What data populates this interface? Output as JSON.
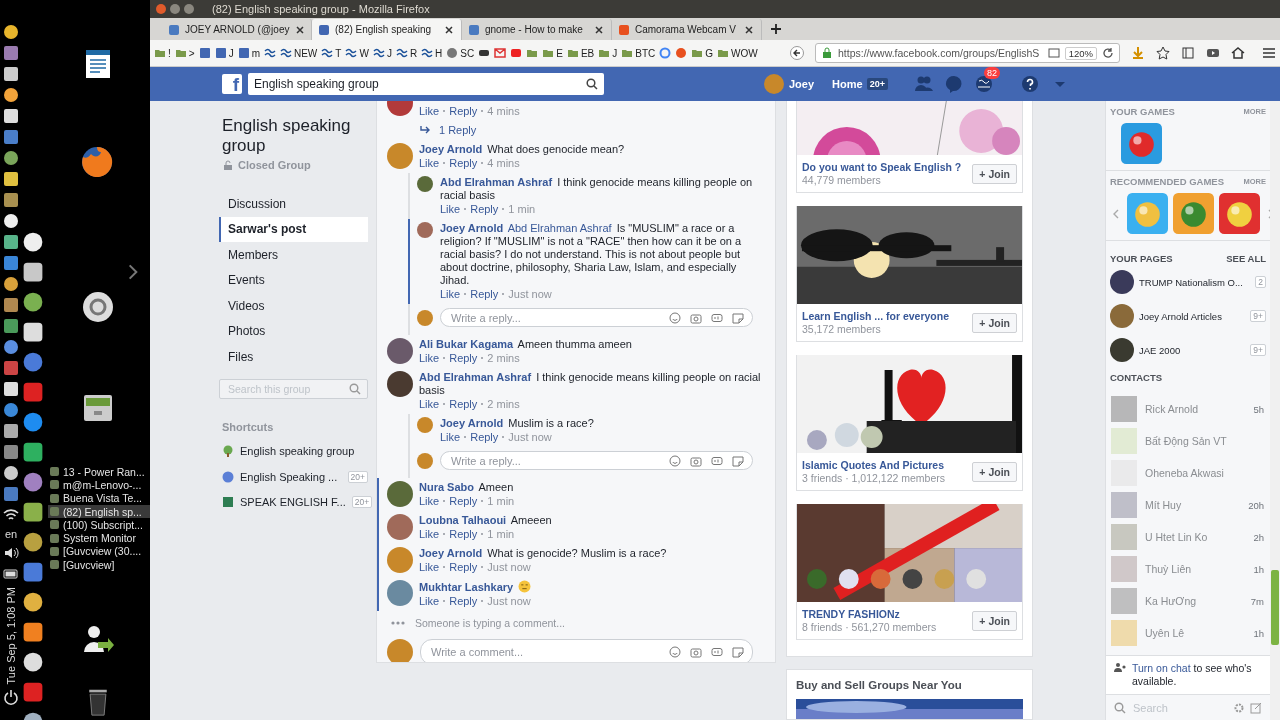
{
  "desktop": {
    "language": "en",
    "clock": "Tue Sep 5, 1:08 PM",
    "windows": [
      {
        "title": "13 - Power Ran...",
        "selected": false
      },
      {
        "title": "m@m-Lenovo-...",
        "selected": false
      },
      {
        "title": "Buena Vista Te...",
        "selected": false
      },
      {
        "title": "(82) English sp...",
        "selected": true
      },
      {
        "title": "(100) Subscript...",
        "selected": false
      },
      {
        "title": "System Monitor",
        "selected": false
      },
      {
        "title": "[Guvcview  (30....",
        "selected": false
      },
      {
        "title": "[Guvcview]",
        "selected": false
      }
    ]
  },
  "browser": {
    "title": "(82) English speaking group - Mozilla Firefox",
    "tabs": [
      {
        "label": "JOEY ARNOLD (@joey",
        "selected": false
      },
      {
        "label": "(82) English speaking",
        "selected": true
      },
      {
        "label": "gnome - How to make",
        "selected": false
      },
      {
        "label": "Camorama Webcam V",
        "selected": false
      }
    ],
    "bookmarks": [
      {
        "kind": "folder",
        "label": "!"
      },
      {
        "kind": "folder",
        "label": ">"
      },
      {
        "kind": "fb"
      },
      {
        "kind": "fb",
        "label": "J"
      },
      {
        "kind": "fb",
        "label": "m"
      },
      {
        "kind": "steem"
      },
      {
        "kind": "steem",
        "label": "NEW"
      },
      {
        "kind": "steem",
        "label": "T"
      },
      {
        "kind": "steem",
        "label": "W"
      },
      {
        "kind": "steem",
        "label": "J"
      },
      {
        "kind": "steem",
        "label": "R"
      },
      {
        "kind": "steem",
        "label": "H"
      },
      {
        "kind": "globe",
        "label": "SC"
      },
      {
        "kind": "car"
      },
      {
        "kind": "mail"
      },
      {
        "kind": "video"
      },
      {
        "kind": "folder"
      },
      {
        "kind": "folder",
        "label": "E"
      },
      {
        "kind": "folder",
        "label": "EB"
      },
      {
        "kind": "folder",
        "label": "J"
      },
      {
        "kind": "folder",
        "label": "BTC"
      },
      {
        "kind": "google"
      },
      {
        "kind": "orange"
      },
      {
        "kind": "folder",
        "label": "G"
      },
      {
        "kind": "folder",
        "label": "WOW"
      }
    ],
    "url": "https://www.facebook.com/groups/EnglishS",
    "zoom": "120%"
  },
  "facebook": {
    "logo": "f",
    "search": {
      "value": "English speaking group"
    },
    "user": "Joey",
    "home": "Home",
    "home_count": "20+",
    "notifications": "82"
  },
  "group": {
    "title": "English speaking group",
    "privacy": "Closed Group",
    "nav": [
      {
        "label": "Discussion",
        "selected": false
      },
      {
        "label": "Sarwar's post",
        "selected": true
      },
      {
        "label": "Members",
        "selected": false
      },
      {
        "label": "Events",
        "selected": false
      },
      {
        "label": "Videos",
        "selected": false
      },
      {
        "label": "Photos",
        "selected": false
      },
      {
        "label": "Files",
        "selected": false
      }
    ],
    "search": {
      "placeholder": "Search this group"
    },
    "shortcuts_title": "Shortcuts",
    "shortcuts": [
      {
        "label": "English speaking group"
      },
      {
        "label": "English Speaking ...",
        "count": "20+"
      },
      {
        "label": "SPEAK ENGLISH F...",
        "count": "20+"
      }
    ]
  },
  "comments": [
    {
      "like": "Like",
      "reply": "Reply",
      "time": "4 mins",
      "highlighted": false,
      "replies_link": "1 Reply"
    },
    {
      "name": "Joey Arnold",
      "text": "What does genocide mean?",
      "like": "Like",
      "reply": "Reply",
      "time": "4 mins",
      "highlighted": false,
      "replies": [
        {
          "name": "Abd Elrahman Ashraf",
          "text": "I think genocide means killing people on racial basis",
          "like": "Like",
          "reply": "Reply",
          "time": "1 min",
          "highlighted": false
        },
        {
          "name": "Joey Arnold",
          "mention": "Abd Elrahman Ashraf",
          "text": "Is \"MUSLIM\" a race or a religion? If \"MUSLIM\" is not a \"RACE\" then how can it be on a racial basis? I do not understand. This is not about people but about doctrine, philosophy, Sharia Law, Islam, and especially Jihad.",
          "like": "Like",
          "reply": "Reply",
          "time": "Just now",
          "highlighted": true
        }
      ],
      "reply_box": {
        "placeholder": "Write a reply..."
      }
    },
    {
      "name": "Ali Bukar Kagama",
      "text": "Ameen thumma ameen",
      "like": "Like",
      "reply": "Reply",
      "time": "2 mins",
      "highlighted": false
    },
    {
      "name": "Abd Elrahman Ashraf",
      "text": "I think genocide means killing people on racial basis",
      "like": "Like",
      "reply": "Reply",
      "time": "2 mins",
      "highlighted": false,
      "replies": [
        {
          "name": "Joey Arnold",
          "text": "Muslim is a race?",
          "like": "Like",
          "reply": "Reply",
          "time": "Just now",
          "highlighted": false
        }
      ],
      "reply_box": {
        "placeholder": "Write a reply..."
      }
    },
    {
      "name": "Nura Sabo",
      "text": "Ameen",
      "like": "Like",
      "reply": "Reply",
      "time": "1 min",
      "highlighted": true
    },
    {
      "name": "Loubna Talhaoui",
      "text": "Ameeen",
      "like": "Like",
      "reply": "Reply",
      "time": "1 min",
      "highlighted": true
    },
    {
      "name": "Joey Arnold",
      "text": "What is genocide? Muslim is a race?",
      "like": "Like",
      "reply": "Reply",
      "time": "Just now",
      "highlighted": true
    },
    {
      "name": "Mukhtar Lashkary",
      "emoji": true,
      "like": "Like",
      "reply": "Reply",
      "time": "Just now",
      "highlighted": true
    }
  ],
  "typing": "Someone is typing a comment...",
  "comment_box": {
    "placeholder": "Write a comment..."
  },
  "suggested_groups": [
    {
      "name": "Do you want to Speak English ?",
      "members": "44,779 members",
      "join": "+ Join"
    },
    {
      "name": "Learn English ... for everyone",
      "members": "35,172 members",
      "join": "+ Join"
    },
    {
      "name": "Islamic Quotes And Pictures",
      "members": "3 friends · 1,012,122 members",
      "join": "+ Join"
    },
    {
      "name": "TRENDY FASHIONz",
      "members": "8 friends · 561,270 members",
      "join": "+ Join"
    }
  ],
  "buy_sell": {
    "title": "Buy and Sell Groups Near You"
  },
  "sidebar": {
    "games": {
      "title": "YOUR GAMES",
      "more": "MORE"
    },
    "recommended": {
      "title": "RECOMMENDED GAMES",
      "more": "MORE"
    },
    "pages": {
      "title": "YOUR PAGES",
      "see_all": "SEE ALL",
      "items": [
        {
          "name": "TRUMP Nationalism O...",
          "count": "2"
        },
        {
          "name": "Joey Arnold Articles",
          "count": "9+"
        },
        {
          "name": "JAE 2000",
          "count": "9+"
        }
      ]
    },
    "contacts": {
      "title": "CONTACTS",
      "chat_on": false,
      "items": [
        {
          "name": "Rick Arnold",
          "time": "5h"
        },
        {
          "name": "Bất Động Sản VT"
        },
        {
          "name": "Oheneba Akwasi"
        },
        {
          "name": "Mít Huy",
          "time": "20h"
        },
        {
          "name": "U Htet Lin Ko",
          "time": "2h"
        },
        {
          "name": "Thuỳ Liên",
          "time": "1h"
        },
        {
          "name": "Ka HưƠng",
          "time": "7m"
        },
        {
          "name": "Uyên Lê",
          "time": "1h"
        }
      ]
    },
    "chat_notice": {
      "link": "Turn on chat",
      "text": " to see who's available."
    },
    "chat_search": {
      "placeholder": "Search"
    }
  }
}
